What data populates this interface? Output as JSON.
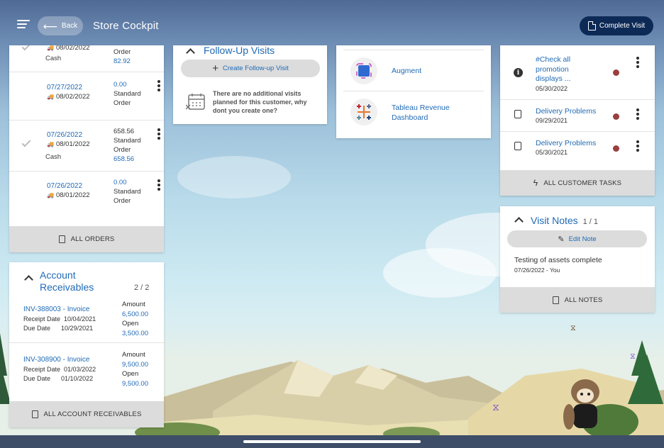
{
  "header": {
    "back_label": "Back",
    "title": "Store Cockpit",
    "complete_label": "Complete Visit"
  },
  "orders": {
    "rows": [
      {
        "date1": "",
        "date2": "08/02/2022",
        "line1": "Order",
        "line2": "82.92",
        "line3": "",
        "line4": "",
        "type": "Cash",
        "checked": true,
        "partial": true
      },
      {
        "date1": "07/27/2022",
        "date2": "08/02/2022",
        "line1": "0.00",
        "line2": "Standard",
        "line3": "Order",
        "line4": "",
        "type": "",
        "checked": false
      },
      {
        "date1": "07/26/2022",
        "date2": "08/01/2022",
        "line1": "658.56",
        "line2": "Standard",
        "line3": "Order",
        "line4": "658.56",
        "type": "Cash",
        "checked": true
      },
      {
        "date1": "07/26/2022",
        "date2": "08/01/2022",
        "line1": "0.00",
        "line2": "Standard",
        "line3": "Order",
        "line4": "",
        "type": "",
        "checked": false
      }
    ],
    "footer_label": "ALL ORDERS"
  },
  "receivables": {
    "title_line1": "Account",
    "title_line2": "Receivables",
    "count": "2 / 2",
    "items": [
      {
        "invoice": "INV-388003 - Invoice",
        "receipt_label": "Receipt Date",
        "receipt_date": "10/04/2021",
        "due_label": "Due Date",
        "due_date": "10/29/2021",
        "amount_label": "Amount",
        "amount": "6,500.00",
        "open_label": "Open",
        "open": "3,500.00"
      },
      {
        "invoice": "INV-308900 - Invoice",
        "receipt_label": "Receipt Date",
        "receipt_date": "01/03/2022",
        "due_label": "Due Date",
        "due_date": "01/10/2022",
        "amount_label": "Amount",
        "amount": "9,500.00",
        "open_label": "Open",
        "open": "9,500.00"
      }
    ],
    "footer_label": "ALL ACCOUNT RECEIVABLES"
  },
  "followup": {
    "title": "Follow-Up Visits",
    "create_label": "Create Follow-up Visit",
    "empty_line1": "There are no additional visits",
    "empty_line2": "planned for this customer, why",
    "empty_line3": "dont you create one?"
  },
  "links": {
    "items": [
      {
        "label_line1": "Augment",
        "label_line2": "",
        "icon": "augment-icon"
      },
      {
        "label_line1": "Tableau Revenue",
        "label_line2": "Dashboard",
        "icon": "tableau-icon"
      }
    ]
  },
  "tasks": {
    "items": [
      {
        "line1": "#Check all",
        "line2": "promotion",
        "line3": "displays ...",
        "date": "05/30/2022",
        "icon": "info-icon"
      },
      {
        "line1": "Delivery Problems",
        "line2": "",
        "line3": "",
        "date": "09/29/2021",
        "icon": "task-icon"
      },
      {
        "line1": "Delivery Problems",
        "line2": "",
        "line3": "",
        "date": "05/30/2021",
        "icon": "task-icon"
      }
    ],
    "footer_label": "ALL CUSTOMER TASKS"
  },
  "notes": {
    "title": "Visit Notes",
    "count": "1 / 1",
    "edit_label": "Edit Note",
    "note_text": "Testing of assets complete",
    "note_meta": "07/26/2022 - You",
    "footer_label": "ALL NOTES"
  }
}
